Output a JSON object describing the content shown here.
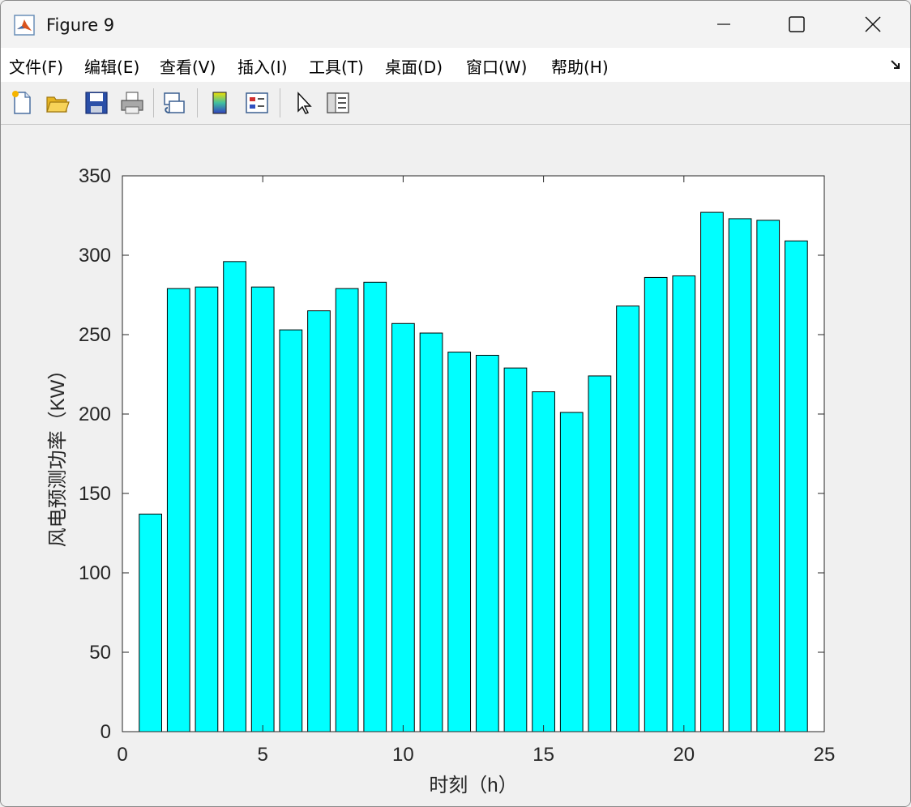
{
  "window": {
    "title": "Figure 9"
  },
  "menu": {
    "items": [
      {
        "label": "文件(F)"
      },
      {
        "label": "编辑(E)"
      },
      {
        "label": "查看(V)"
      },
      {
        "label": "插入(I)"
      },
      {
        "label": "工具(T)"
      },
      {
        "label": "桌面(D)"
      },
      {
        "label": "窗口(W)"
      },
      {
        "label": "帮助(H)"
      }
    ]
  },
  "toolbar": {
    "icons": [
      "new-figure-icon",
      "open-file-icon",
      "save-icon",
      "print-icon",
      "link-plot-icon",
      "colorbar-icon",
      "legend-icon",
      "pointer-icon",
      "property-inspector-icon"
    ]
  },
  "colors": {
    "bar_fill": "#00ffff",
    "bar_edge": "#000000",
    "axes_bg": "#ffffff",
    "figure_bg": "#f0f0f0"
  },
  "chart_data": {
    "type": "bar",
    "title": "",
    "xlabel": "时刻（h）",
    "ylabel": "风电预测功率（KW）",
    "x": [
      1,
      2,
      3,
      4,
      5,
      6,
      7,
      8,
      9,
      10,
      11,
      12,
      13,
      14,
      15,
      16,
      17,
      18,
      19,
      20,
      21,
      22,
      23,
      24
    ],
    "values": [
      137,
      279,
      280,
      296,
      280,
      253,
      265,
      279,
      283,
      257,
      251,
      239,
      237,
      229,
      214,
      201,
      224,
      268,
      286,
      287,
      327,
      323,
      322,
      309
    ],
    "xlim": [
      0,
      25
    ],
    "ylim": [
      0,
      350
    ],
    "xticks": [
      0,
      5,
      10,
      15,
      20,
      25
    ],
    "yticks": [
      0,
      50,
      100,
      150,
      200,
      250,
      300,
      350
    ],
    "grid": false,
    "legend": false
  }
}
